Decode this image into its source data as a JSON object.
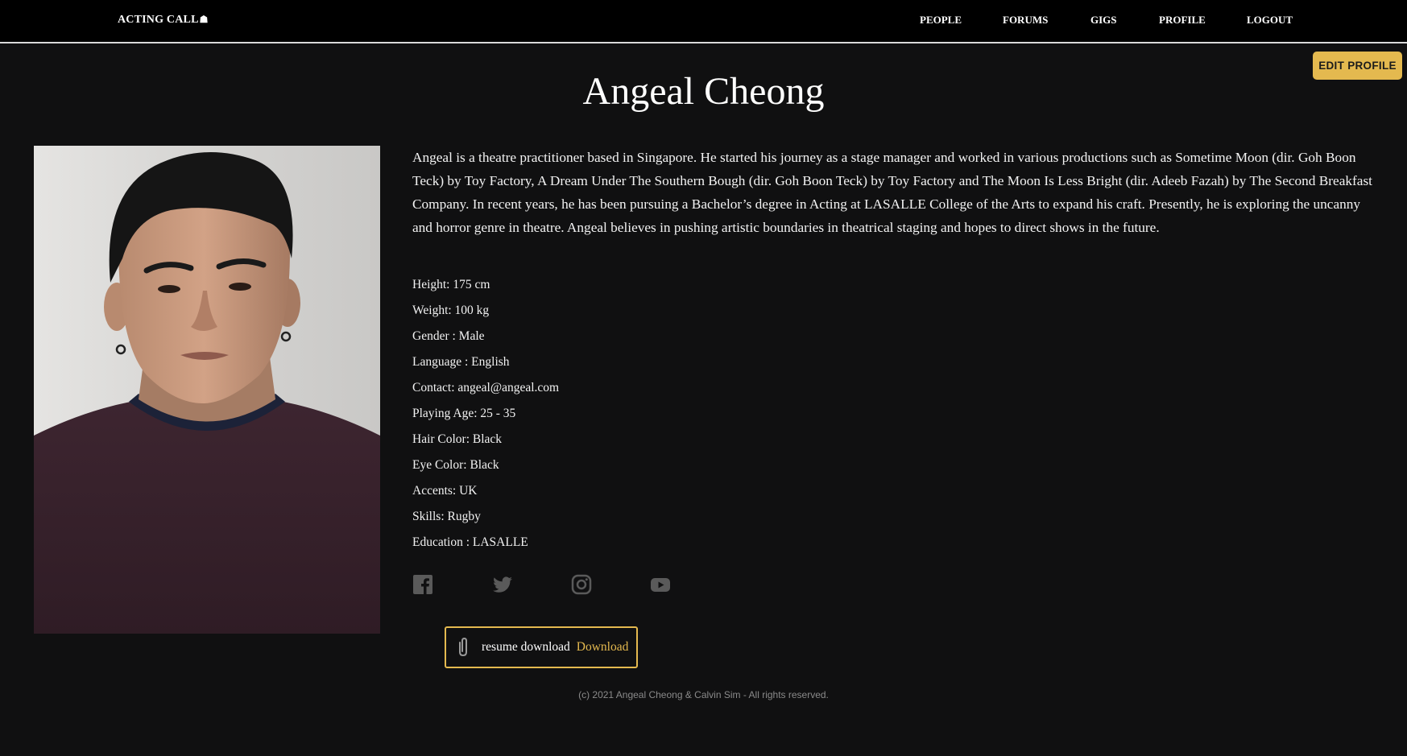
{
  "header": {
    "brand": "ACTING CALL",
    "brand_icon": "mask-icon",
    "nav": [
      "PEOPLE",
      "FORUMS",
      "GIGS",
      "PROFILE",
      "LOGOUT"
    ]
  },
  "edit_button": "EDIT PROFILE",
  "profile": {
    "name": "Angeal Cheong",
    "bio": "Angeal is a theatre practitioner based in Singapore. He started his journey as a stage manager and worked in various productions such as Sometime Moon (dir. Goh Boon Teck) by Toy Factory, A Dream Under The Southern Bough (dir. Goh Boon Teck) by Toy Factory and The Moon Is Less Bright (dir. Adeeb Fazah) by The Second Breakfast Company. In recent years, he has been pursuing a Bachelor’s degree in Acting at LASALLE College of the Arts to expand his craft. Presently, he is exploring the uncanny and horror genre in theatre. Angeal believes in pushing artistic boundaries in theatrical staging and hopes to direct shows in the future.",
    "details": [
      "Height: 175 cm",
      "Weight: 100 kg",
      "Gender : Male",
      "Language : English",
      "Contact: angeal@angeal.com",
      "Playing Age: 25 - 35",
      "Hair Color: Black",
      "Eye Color: Black",
      "Accents: UK",
      "Skills: Rugby",
      "Education : LASALLE"
    ],
    "socials": [
      "facebook-icon",
      "twitter-icon",
      "instagram-icon",
      "youtube-icon"
    ]
  },
  "resume": {
    "label": "resume download",
    "link": "Download"
  },
  "footer": "(c) 2021 Angeal Cheong & Calvin Sim - All rights reserved.",
  "colors": {
    "background": "#101011",
    "accent": "#e4b94f",
    "topbar": "#000000"
  }
}
